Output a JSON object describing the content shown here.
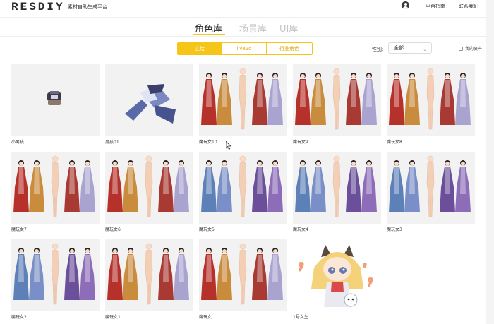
{
  "header": {
    "logo": "RESDIY",
    "tagline": "素材自助生成平台",
    "links": {
      "guide": "平台指南",
      "contact": "联系我们"
    }
  },
  "tabs": [
    "角色库",
    "场景库",
    "UI库"
  ],
  "filters": {
    "categories": [
      "立绘",
      "live2d",
      "行业角色"
    ],
    "gender_label": "性别:",
    "gender_value": "全部",
    "my_assets": "我的资产"
  },
  "cards": [
    {
      "label": "小男孩",
      "art": "boy-small"
    },
    {
      "label": "男孩01",
      "art": "boy-ribbon"
    },
    {
      "label": "魔玩女10",
      "art": "lineup-red"
    },
    {
      "label": "魔玩女9",
      "art": "lineup-red"
    },
    {
      "label": "魔玩女8",
      "art": "lineup-red"
    },
    {
      "label": "魔玩女7",
      "art": "lineup-red"
    },
    {
      "label": "魔玩女6",
      "art": "lineup-red"
    },
    {
      "label": "魔玩女5",
      "art": "lineup-blue"
    },
    {
      "label": "魔玩女4",
      "art": "lineup-blue"
    },
    {
      "label": "魔玩女3",
      "art": "lineup-blue"
    },
    {
      "label": "魔玩女2",
      "art": "lineup-blue"
    },
    {
      "label": "魔玩女1",
      "art": "lineup-red"
    },
    {
      "label": "魔玩女",
      "art": "lineup-red"
    },
    {
      "label": "1号女生",
      "art": "chibi-cat"
    }
  ],
  "colors": {
    "accent": "#f5c518",
    "muted_tab": "#c4c4c4",
    "thumb_bg": "#f2f2f2"
  }
}
